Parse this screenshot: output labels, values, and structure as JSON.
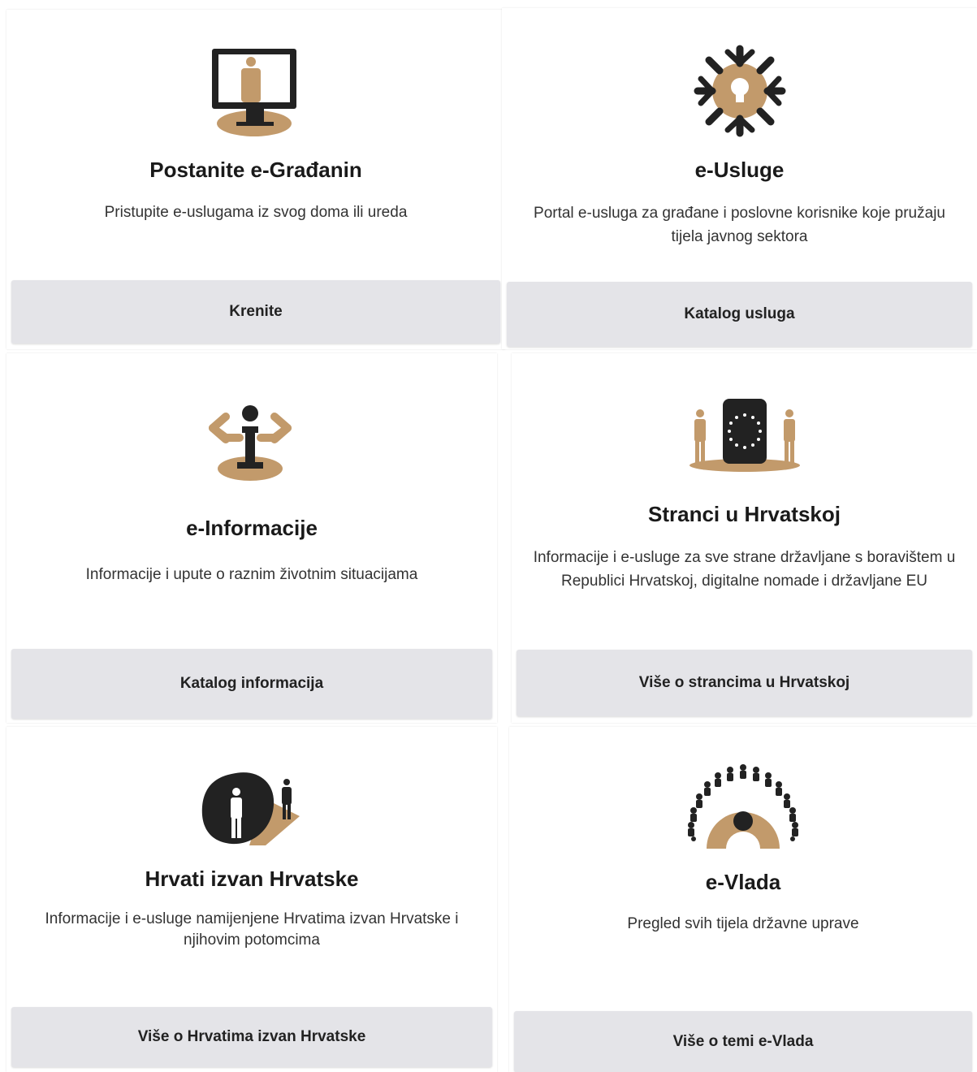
{
  "colors": {
    "accent": "#c29a6b",
    "dark": "#222222",
    "button_bg": "#e4e4e8"
  },
  "cards": [
    {
      "icon": "e-citizen-monitor-icon",
      "title": "Postanite e-Građanin",
      "description": "Pristupite e-uslugama iz svog doma ili ureda",
      "button": "Krenite"
    },
    {
      "icon": "e-services-arrows-icon",
      "title": "e-Usluge",
      "description": "Portal e-usluga za građane i poslovne korisnike koje pružaju tijela javnog sektora",
      "button": "Katalog usluga"
    },
    {
      "icon": "information-person-icon",
      "title": "e-Informacije",
      "description": "Informacije i upute o raznim životnim situacijama",
      "button": "Katalog informacija"
    },
    {
      "icon": "eu-flag-people-icon",
      "title": "Stranci u Hrvatskoj",
      "description": "Informacije i e-usluge za sve strane državljane s boravištem u Republici Hrvatskoj, digitalne nomade i državljane EU",
      "button": "Više o strancima u Hrvatskoj"
    },
    {
      "icon": "croatians-abroad-icon",
      "title": "Hrvati izvan Hrvatske",
      "description": "Informacije i e-usluge namijenjene Hrvatima izvan Hrvatske i njihovim potomcima",
      "button": "Više o Hrvatima izvan Hrvatske"
    },
    {
      "icon": "e-government-people-circle-icon",
      "title": "e-Vlada",
      "description": "Pregled svih tijela državne uprave",
      "button": "Više o temi e-Vlada"
    }
  ]
}
